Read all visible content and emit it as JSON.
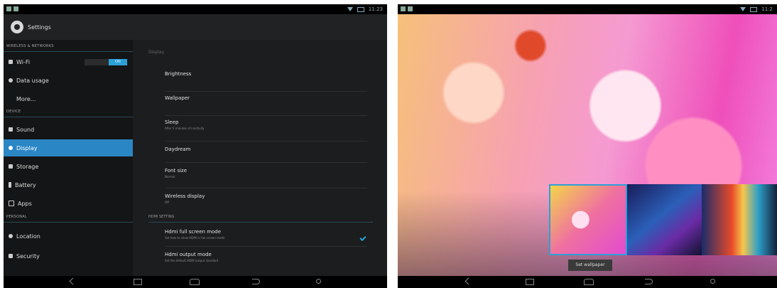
{
  "left": {
    "status": {
      "time": "11:23"
    },
    "actionbar": {
      "title": "Settings"
    },
    "sidebar": {
      "sections": [
        {
          "label": "WIRELESS & NETWORKS"
        },
        {
          "label": "DEVICE"
        },
        {
          "label": "PERSONAL"
        }
      ],
      "items": [
        {
          "label": "Wi-Fi",
          "toggle": "ON"
        },
        {
          "label": "Data usage"
        },
        {
          "label": "More..."
        },
        {
          "label": "Sound"
        },
        {
          "label": "Display"
        },
        {
          "label": "Storage"
        },
        {
          "label": "Battery"
        },
        {
          "label": "Apps"
        },
        {
          "label": "Location"
        },
        {
          "label": "Security"
        }
      ],
      "active": "Display"
    },
    "content": {
      "title": "Display",
      "rows": [
        {
          "title": "Brightness"
        },
        {
          "title": "Wallpaper"
        },
        {
          "title": "Sleep",
          "subtitle": "After 5 minutes of inactivity"
        },
        {
          "title": "Daydream"
        },
        {
          "title": "Font size",
          "subtitle": "Normal"
        },
        {
          "title": "Wireless display",
          "subtitle": "Off"
        }
      ],
      "hdmi_header": "HDMI SETTING",
      "hdmi_rows": [
        {
          "title": "Hdmi full screen mode",
          "subtitle": "Set how to show HDMI in full screen mode",
          "checked": true
        },
        {
          "title": "Hdmi output mode",
          "subtitle": "Set the default HDMI output standard"
        }
      ]
    }
  },
  "right": {
    "status": {
      "time": "11:2"
    },
    "set_wallpaper_label": "Set wallpaper",
    "thumbnails": [
      "wallpaper-pink-bubbles",
      "wallpaper-blue-rays",
      "wallpaper-spectrum"
    ]
  },
  "colors": {
    "accent": "#2a86c5",
    "toggle_on": "#2ba0d8",
    "sidebar_bg": "#141516",
    "content_bg": "#1c1d1f"
  },
  "icons": [
    "wifi-icon",
    "data-usage-icon",
    "sound-icon",
    "display-icon",
    "storage-icon",
    "battery-icon",
    "apps-icon",
    "location-icon",
    "security-icon",
    "back-icon",
    "home-icon",
    "recent-apps-icon",
    "settings-gear-icon"
  ]
}
